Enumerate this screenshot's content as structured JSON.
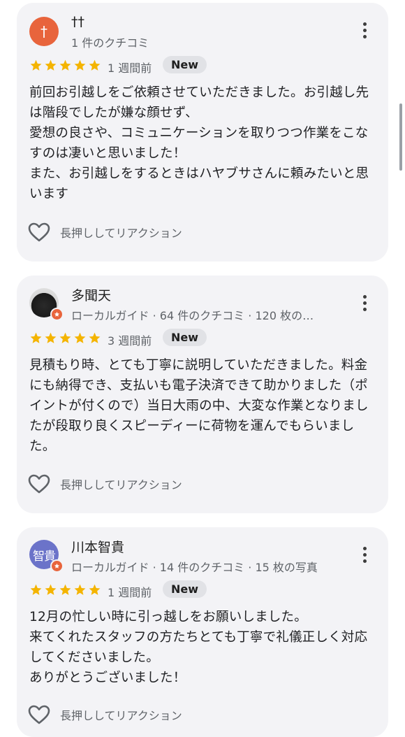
{
  "colors": {
    "star": "#f4b400",
    "avatar_orange": "#e8643c",
    "avatar_purple": "#6b73c9",
    "card_bg": "#f3f3f6"
  },
  "reviews": [
    {
      "avatar_text": "†",
      "name": "††",
      "meta": "1 件のクチコミ",
      "rating": 5,
      "time": "1 週間前",
      "badge": "New",
      "text": "前回お引越しをご依頼させていただきました。お引越し先は階段でしたが嫌な顔せず、\n愛想の良さや、コミュニケーションを取りつつ作業をこなすのは凄いと思いました！\nまた、お引越しをするときはハヤブサさんに頼みたいと思います",
      "reaction_label": "長押ししてリアクション"
    },
    {
      "avatar_text": "",
      "name": "多聞天",
      "meta": "ローカルガイド · 64 件のクチコミ · 120 枚の…",
      "rating": 5,
      "time": "3 週間前",
      "badge": "New",
      "text": "見積もり時、とても丁寧に説明していただきました。料金にも納得でき、支払いも電子決済できて助かりました（ポイントが付くので）当日大雨の中、大変な作業となりましたが段取り良くスピーディーに荷物を運んでもらいました。",
      "reaction_label": "長押ししてリアクション"
    },
    {
      "avatar_text": "智貴",
      "name": "川本智貴",
      "meta": "ローカルガイド · 14 件のクチコミ · 15 枚の写真",
      "rating": 5,
      "time": "1 週間前",
      "badge": "New",
      "text": "12月の忙しい時に引っ越しをお願いしました。\n来てくれたスタッフの方たちとても丁寧で礼儀正しく対応してくださいました。\nありがとうございました！",
      "reaction_label": "長押ししてリアクション"
    }
  ]
}
